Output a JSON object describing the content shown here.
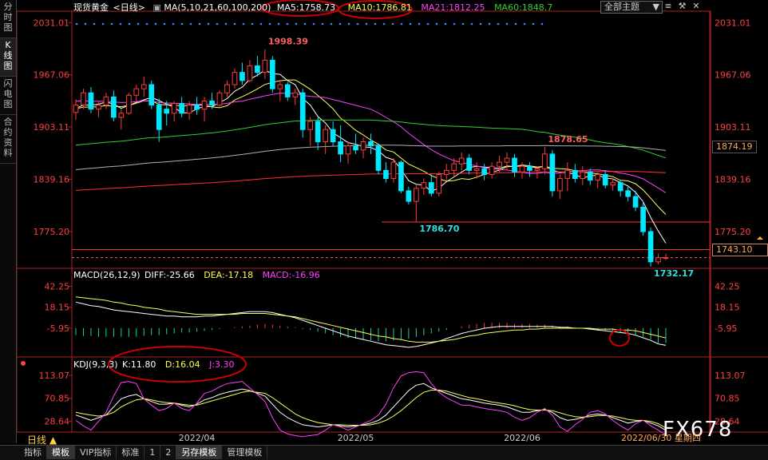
{
  "sidebar": [
    {
      "label": "分时图",
      "active": false
    },
    {
      "label": "K线图",
      "active": true
    },
    {
      "label": "闪电图",
      "active": false
    },
    {
      "label": "合约资料",
      "active": false
    }
  ],
  "header": {
    "instrument": "现货黄金",
    "period": "<日线>",
    "ma_params": "MA(5,10,21,60,100,200)",
    "ma5": "MA5:1758.73",
    "ma10": "MA10:1786.81",
    "ma21": "MA21:1812.25",
    "ma60": "MA60:1848.7",
    "theme_select": "全部主题"
  },
  "macd_header": {
    "params": "MACD(26,12,9)",
    "diff": "DIFF:-25.66",
    "dea": "DEA:-17.18",
    "macd": "MACD:-16.96"
  },
  "kdj_header": {
    "params": "KDJ(9,3,3)",
    "k": "K:11.80",
    "d": "D:16.04",
    "j": "J:3.30"
  },
  "current_price": "1743.10",
  "level_marker": "1874.19",
  "watermark": "FX678",
  "date_label": "2022/06/30 星期四",
  "bottom_period": "日线",
  "bottom_tabs": [
    {
      "label": "指标",
      "active": false
    },
    {
      "label": "模板",
      "active": true
    },
    {
      "label": "VIP指标",
      "active": false
    },
    {
      "label": "标准",
      "active": false
    },
    {
      "label": "1",
      "active": false
    },
    {
      "label": "2",
      "active": false
    },
    {
      "label": "另存模板",
      "active": true
    },
    {
      "label": "管理模板",
      "active": false
    }
  ],
  "colors": {
    "up": "#ff3c3c",
    "down": "#00e8ff",
    "ma5": "#ffffff",
    "ma10": "#ffff55",
    "ma21": "#ff40ff",
    "ma60": "#30d030",
    "ma100": "#b0b0b0",
    "ma200": "#ff3030",
    "axis": "#ff4040",
    "annotation": "#cc0000"
  },
  "chart_data": [
    {
      "type": "candlestick",
      "title": "现货黄金 日线",
      "x": [
        "2022/04",
        "2022/05",
        "2022/06"
      ],
      "ylim": [
        1730,
        2045
      ],
      "yticks": [
        2031.01,
        1967.06,
        1903.11,
        1839.16,
        1775.2
      ],
      "highlights": [
        {
          "label": "1998.39",
          "value": 1998.39
        },
        {
          "label": "1878.65",
          "value": 1878.65
        },
        {
          "label": "1786.70",
          "value": 1786.7
        },
        {
          "label": "1732.17",
          "value": 1732.17
        }
      ],
      "candles": [
        [
          1921,
          1937,
          1912,
          1930
        ],
        [
          1930,
          1950,
          1925,
          1945
        ],
        [
          1945,
          1952,
          1920,
          1925
        ],
        [
          1925,
          1935,
          1915,
          1930
        ],
        [
          1930,
          1945,
          1925,
          1940
        ],
        [
          1940,
          1948,
          1910,
          1915
        ],
        [
          1915,
          1925,
          1900,
          1920
        ],
        [
          1920,
          1945,
          1918,
          1942
        ],
        [
          1942,
          1955,
          1935,
          1950
        ],
        [
          1950,
          1965,
          1940,
          1955
        ],
        [
          1955,
          1960,
          1925,
          1930
        ],
        [
          1930,
          1938,
          1885,
          1900
        ],
        [
          1925,
          1935,
          1905,
          1920
        ],
        [
          1920,
          1935,
          1910,
          1932
        ],
        [
          1932,
          1940,
          1915,
          1920
        ],
        [
          1920,
          1935,
          1912,
          1930
        ],
        [
          1930,
          1940,
          1918,
          1925
        ],
        [
          1925,
          1940,
          1910,
          1935
        ],
        [
          1935,
          1945,
          1925,
          1930
        ],
        [
          1930,
          1948,
          1928,
          1945
        ],
        [
          1945,
          1960,
          1940,
          1955
        ],
        [
          1955,
          1975,
          1950,
          1970
        ],
        [
          1970,
          1982,
          1955,
          1960
        ],
        [
          1960,
          1985,
          1958,
          1978
        ],
        [
          1978,
          1990,
          1965,
          1970
        ],
        [
          1970,
          1998.39,
          1962,
          1985
        ],
        [
          1985,
          1990,
          1945,
          1950
        ],
        [
          1950,
          1960,
          1935,
          1955
        ],
        [
          1955,
          1958,
          1935,
          1940
        ],
        [
          1940,
          1950,
          1930,
          1945
        ],
        [
          1945,
          1950,
          1890,
          1900
        ],
        [
          1900,
          1915,
          1880,
          1910
        ],
        [
          1910,
          1915,
          1875,
          1885
        ],
        [
          1885,
          1905,
          1870,
          1900
        ],
        [
          1900,
          1910,
          1880,
          1885
        ],
        [
          1885,
          1905,
          1860,
          1870
        ],
        [
          1870,
          1885,
          1858,
          1880
        ],
        [
          1880,
          1895,
          1870,
          1875
        ],
        [
          1875,
          1890,
          1865,
          1885
        ],
        [
          1885,
          1895,
          1870,
          1880
        ],
        [
          1880,
          1882,
          1845,
          1850
        ],
        [
          1850,
          1860,
          1835,
          1840
        ],
        [
          1840,
          1865,
          1835,
          1860
        ],
        [
          1860,
          1862,
          1822,
          1825
        ],
        [
          1825,
          1830,
          1808,
          1812
        ],
        [
          1812,
          1832,
          1786.7,
          1828
        ],
        [
          1828,
          1840,
          1820,
          1835
        ],
        [
          1835,
          1845,
          1818,
          1822
        ],
        [
          1822,
          1848,
          1818,
          1845
        ],
        [
          1845,
          1858,
          1838,
          1850
        ],
        [
          1850,
          1865,
          1842,
          1858
        ],
        [
          1858,
          1872,
          1850,
          1865
        ],
        [
          1865,
          1870,
          1845,
          1850
        ],
        [
          1850,
          1860,
          1840,
          1852
        ],
        [
          1852,
          1858,
          1838,
          1845
        ],
        [
          1845,
          1860,
          1840,
          1855
        ],
        [
          1855,
          1868,
          1848,
          1860
        ],
        [
          1860,
          1872,
          1850,
          1865
        ],
        [
          1865,
          1870,
          1842,
          1848
        ],
        [
          1848,
          1860,
          1840,
          1855
        ],
        [
          1855,
          1860,
          1842,
          1850
        ],
        [
          1850,
          1855,
          1840,
          1852
        ],
        [
          1852,
          1878.65,
          1845,
          1870
        ],
        [
          1870,
          1875,
          1818,
          1825
        ],
        [
          1825,
          1845,
          1815,
          1840
        ],
        [
          1840,
          1860,
          1825,
          1850
        ],
        [
          1850,
          1858,
          1835,
          1840
        ],
        [
          1840,
          1855,
          1832,
          1848
        ],
        [
          1848,
          1852,
          1832,
          1838
        ],
        [
          1838,
          1848,
          1828,
          1845
        ],
        [
          1845,
          1850,
          1828,
          1832
        ],
        [
          1832,
          1840,
          1825,
          1835
        ],
        [
          1835,
          1838,
          1818,
          1825
        ],
        [
          1825,
          1830,
          1812,
          1818
        ],
        [
          1818,
          1825,
          1800,
          1805
        ],
        [
          1805,
          1812,
          1770,
          1775
        ],
        [
          1775,
          1780,
          1732.17,
          1738
        ],
        [
          1738,
          1748,
          1735,
          1743.1
        ],
        [
          1743.1,
          1748,
          1740,
          1743.1
        ]
      ]
    },
    {
      "type": "bar",
      "title": "MACD(26,12,9)",
      "ylim": [
        -40,
        50
      ],
      "yticks": [
        42.25,
        18.15,
        -5.95
      ],
      "series": [
        {
          "name": "MACD",
          "values": [
            -8,
            -9,
            -9,
            -10,
            -10,
            -10,
            -10,
            -10,
            -10,
            -9,
            -8,
            -8,
            -7,
            -6,
            -5,
            -5,
            -4,
            -3,
            -2,
            -1,
            0,
            1,
            2,
            3,
            4,
            5,
            4,
            3,
            2,
            1,
            -1,
            -2,
            -4,
            -6,
            -8,
            -10,
            -11,
            -12,
            -13,
            -14,
            -15,
            -15,
            -14,
            -13,
            -12,
            -10,
            -8,
            -6,
            -4,
            -2,
            0,
            2,
            4,
            5,
            6,
            6,
            6,
            6,
            5,
            5,
            5,
            4,
            4,
            3,
            2,
            2,
            1,
            0,
            -1,
            -2,
            -3,
            -4,
            -5,
            -6,
            -8,
            -10,
            -13,
            -16.96,
            -16.96
          ]
        }
      ]
    },
    {
      "type": "line",
      "title": "MACD(26,12,9)",
      "ylim": [
        -40,
        50
      ],
      "series": [
        {
          "name": "DIFF",
          "values": [
            24,
            22,
            20,
            19,
            17,
            15,
            14,
            13,
            12,
            11,
            10,
            9,
            8,
            8,
            7,
            7,
            7,
            8,
            8,
            9,
            10,
            11,
            12,
            13,
            13,
            13,
            12,
            10,
            8,
            6,
            3,
            0,
            -3,
            -6,
            -9,
            -12,
            -15,
            -17,
            -19,
            -21,
            -23,
            -25,
            -26,
            -27,
            -28,
            -27,
            -25,
            -23,
            -21,
            -18,
            -15,
            -12,
            -10,
            -8,
            -6,
            -5,
            -4,
            -4,
            -4,
            -4,
            -4,
            -4,
            -4,
            -4,
            -5,
            -5,
            -6,
            -6,
            -7,
            -8,
            -9,
            -10,
            -11,
            -12,
            -14,
            -17,
            -20,
            -24,
            -25.66
          ]
        },
        {
          "name": "DEA",
          "values": [
            30,
            29,
            28,
            27,
            26,
            24,
            23,
            21,
            20,
            18,
            17,
            16,
            14,
            13,
            12,
            11,
            10,
            10,
            10,
            10,
            10,
            10,
            11,
            11,
            11,
            11,
            10,
            9,
            8,
            7,
            5,
            3,
            1,
            -1,
            -3,
            -5,
            -7,
            -9,
            -11,
            -13,
            -15,
            -16,
            -18,
            -19,
            -21,
            -22,
            -22,
            -22,
            -21,
            -20,
            -19,
            -17,
            -15,
            -14,
            -12,
            -11,
            -10,
            -9,
            -8,
            -8,
            -7,
            -7,
            -6,
            -6,
            -6,
            -6,
            -6,
            -6,
            -6,
            -7,
            -7,
            -7,
            -8,
            -8,
            -9,
            -11,
            -13,
            -15,
            -17.18
          ]
        }
      ]
    },
    {
      "type": "line",
      "title": "KDJ(9,3,3)",
      "ylim": [
        10,
        125
      ],
      "yticks": [
        113.07,
        70.85,
        28.64
      ],
      "series": [
        {
          "name": "K",
          "values": [
            40,
            35,
            30,
            35,
            40,
            55,
            70,
            75,
            78,
            70,
            65,
            60,
            60,
            62,
            58,
            55,
            60,
            68,
            72,
            78,
            82,
            85,
            88,
            85,
            80,
            75,
            60,
            45,
            35,
            28,
            22,
            20,
            18,
            20,
            22,
            20,
            18,
            20,
            22,
            25,
            30,
            40,
            55,
            70,
            85,
            95,
            98,
            90,
            85,
            80,
            75,
            70,
            68,
            65,
            62,
            60,
            58,
            55,
            50,
            45,
            45,
            48,
            50,
            45,
            35,
            30,
            32,
            35,
            40,
            42,
            40,
            35,
            30,
            25,
            28,
            30,
            25,
            20,
            11.8
          ]
        },
        {
          "name": "D",
          "values": [
            45,
            42,
            40,
            38,
            40,
            45,
            55,
            62,
            68,
            70,
            68,
            65,
            63,
            62,
            60,
            58,
            58,
            62,
            66,
            70,
            74,
            78,
            82,
            84,
            82,
            80,
            72,
            62,
            52,
            42,
            35,
            30,
            26,
            24,
            22,
            22,
            21,
            21,
            21,
            22,
            25,
            30,
            38,
            48,
            60,
            72,
            82,
            86,
            86,
            84,
            80,
            76,
            72,
            70,
            67,
            64,
            62,
            60,
            57,
            53,
            50,
            49,
            49,
            48,
            44,
            40,
            37,
            36,
            37,
            39,
            39,
            38,
            35,
            32,
            30,
            30,
            28,
            24,
            16.04
          ]
        },
        {
          "name": "J",
          "values": [
            30,
            20,
            12,
            28,
            45,
            75,
            100,
            102,
            98,
            70,
            58,
            48,
            52,
            62,
            52,
            48,
            62,
            80,
            84,
            92,
            98,
            100,
            102,
            90,
            78,
            65,
            35,
            12,
            5,
            2,
            0,
            2,
            4,
            12,
            22,
            18,
            12,
            18,
            24,
            30,
            40,
            60,
            90,
            112,
            118,
            120,
            118,
            98,
            82,
            72,
            65,
            58,
            58,
            55,
            52,
            50,
            48,
            45,
            36,
            30,
            35,
            45,
            52,
            40,
            18,
            10,
            22,
            32,
            45,
            48,
            42,
            30,
            20,
            12,
            24,
            30,
            20,
            12,
            3.3
          ]
        }
      ]
    }
  ]
}
